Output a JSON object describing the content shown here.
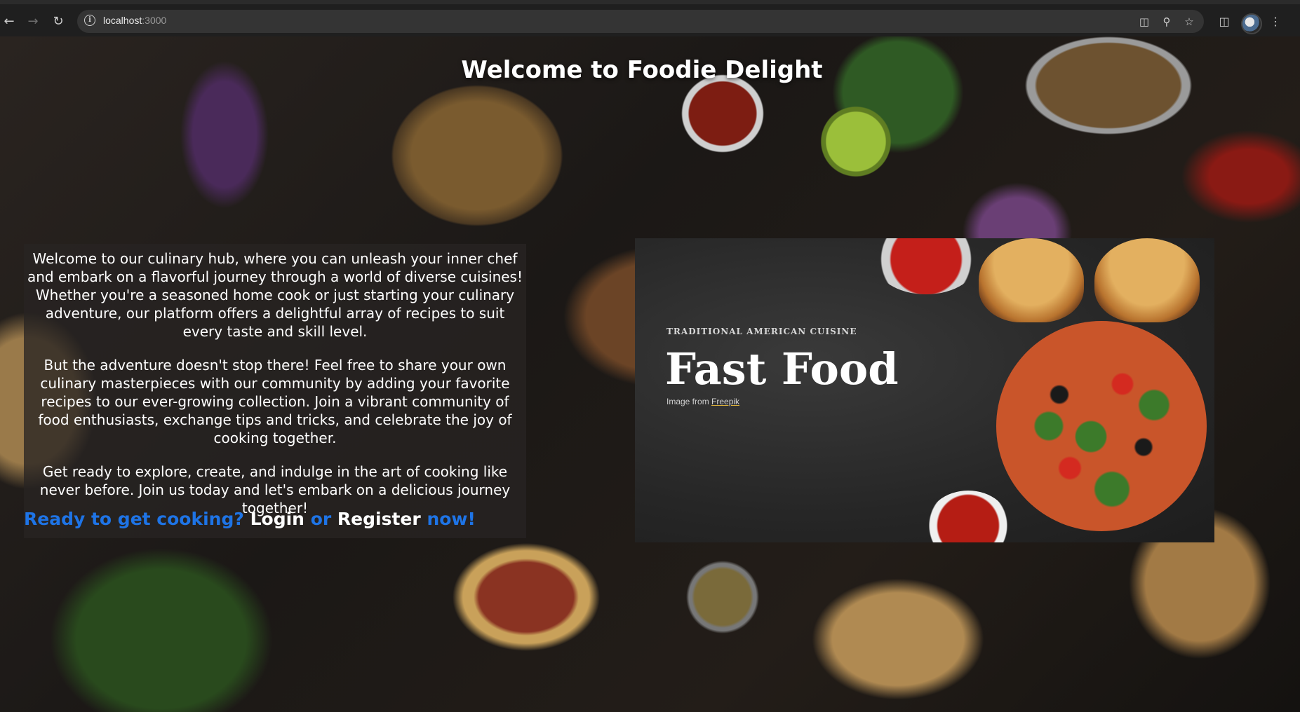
{
  "browser": {
    "url_host": "localhost",
    "url_port": ":3000",
    "icons": [
      "back-icon",
      "forward-icon",
      "reload-icon",
      "site-info-icon",
      "install-app-icon",
      "zoom-icon",
      "bookmark-star-icon",
      "side-panel-icon",
      "profile-avatar",
      "menu-kebab-icon"
    ]
  },
  "page": {
    "title": "Welcome to Foodie Delight",
    "intro": {
      "paragraph1": "Welcome to our culinary hub, where you can unleash your inner chef and embark on a flavorful journey through a world of diverse cuisines! Whether you're a seasoned home cook or just starting your culinary adventure, our platform offers a delightful array of recipes to suit every taste and skill level.",
      "paragraph2": "But the adventure doesn't stop there! Feel free to share your own culinary masterpieces with our community by adding your favorite recipes to our ever-growing collection. Join a vibrant community of food enthusiasts, exchange tips and tricks, and celebrate the joy of cooking together.",
      "paragraph3": "Get ready to explore, create, and indulge in the art of cooking like never before. Join us today and let's embark on a delicious journey together!"
    },
    "cta": {
      "prefix": "Ready to get cooking?",
      "login": "Login",
      "or": "or",
      "register": "Register",
      "suffix": "now!"
    },
    "banner": {
      "tag": "TRADITIONAL AMERICAN CUISINE",
      "headline": "Fast Food",
      "credit_prefix": "Image from",
      "credit_link": "Freepik"
    }
  },
  "colors": {
    "accent_blue": "#1e74e6",
    "title_white": "#ffffff"
  }
}
